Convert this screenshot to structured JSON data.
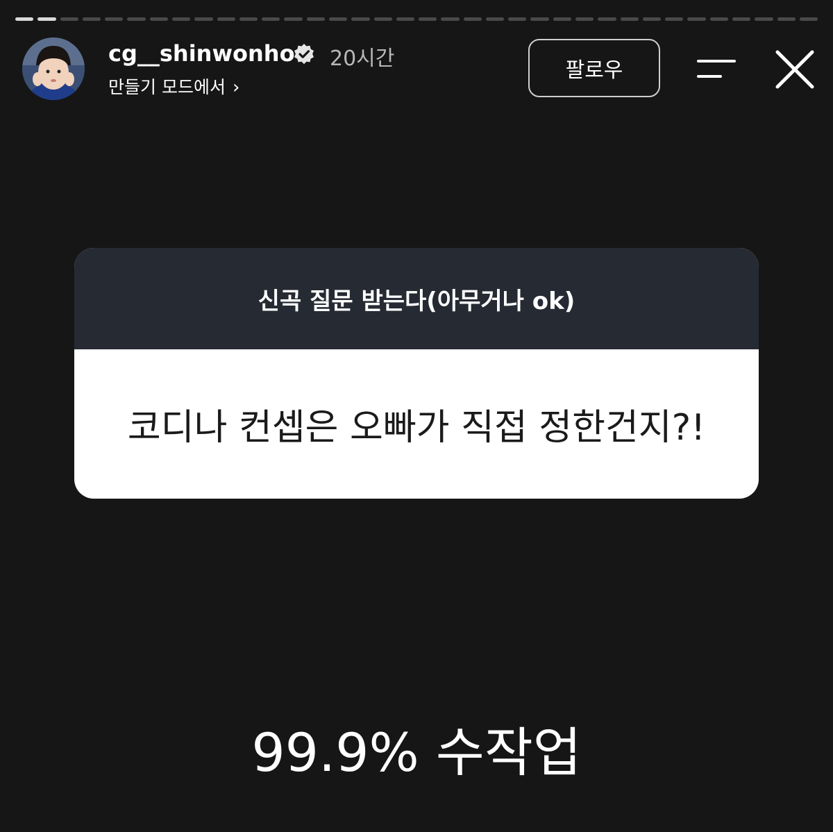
{
  "header": {
    "username": "cg__shinwonho",
    "time": "20시간",
    "subtitle": "만들기 모드에서",
    "subtitle_chevron": "›",
    "follow_label": "팔로우"
  },
  "icons": {
    "verified": "verified-badge-icon",
    "menu": "menu-icon",
    "close": "close-icon",
    "chevron": "chevron-right-icon"
  },
  "story": {
    "progress_done_count": 2,
    "progress_total": 36
  },
  "question_card": {
    "prompt": "신곡 질문 받는다(아무거나 ok)",
    "question": "코디나 컨셉은 오빠가 직접 정한건지?!"
  },
  "answer": {
    "text": "99.9% 수작업"
  },
  "colors": {
    "background": "#161616",
    "card_header": "#262a33",
    "card_body": "#ffffff"
  }
}
